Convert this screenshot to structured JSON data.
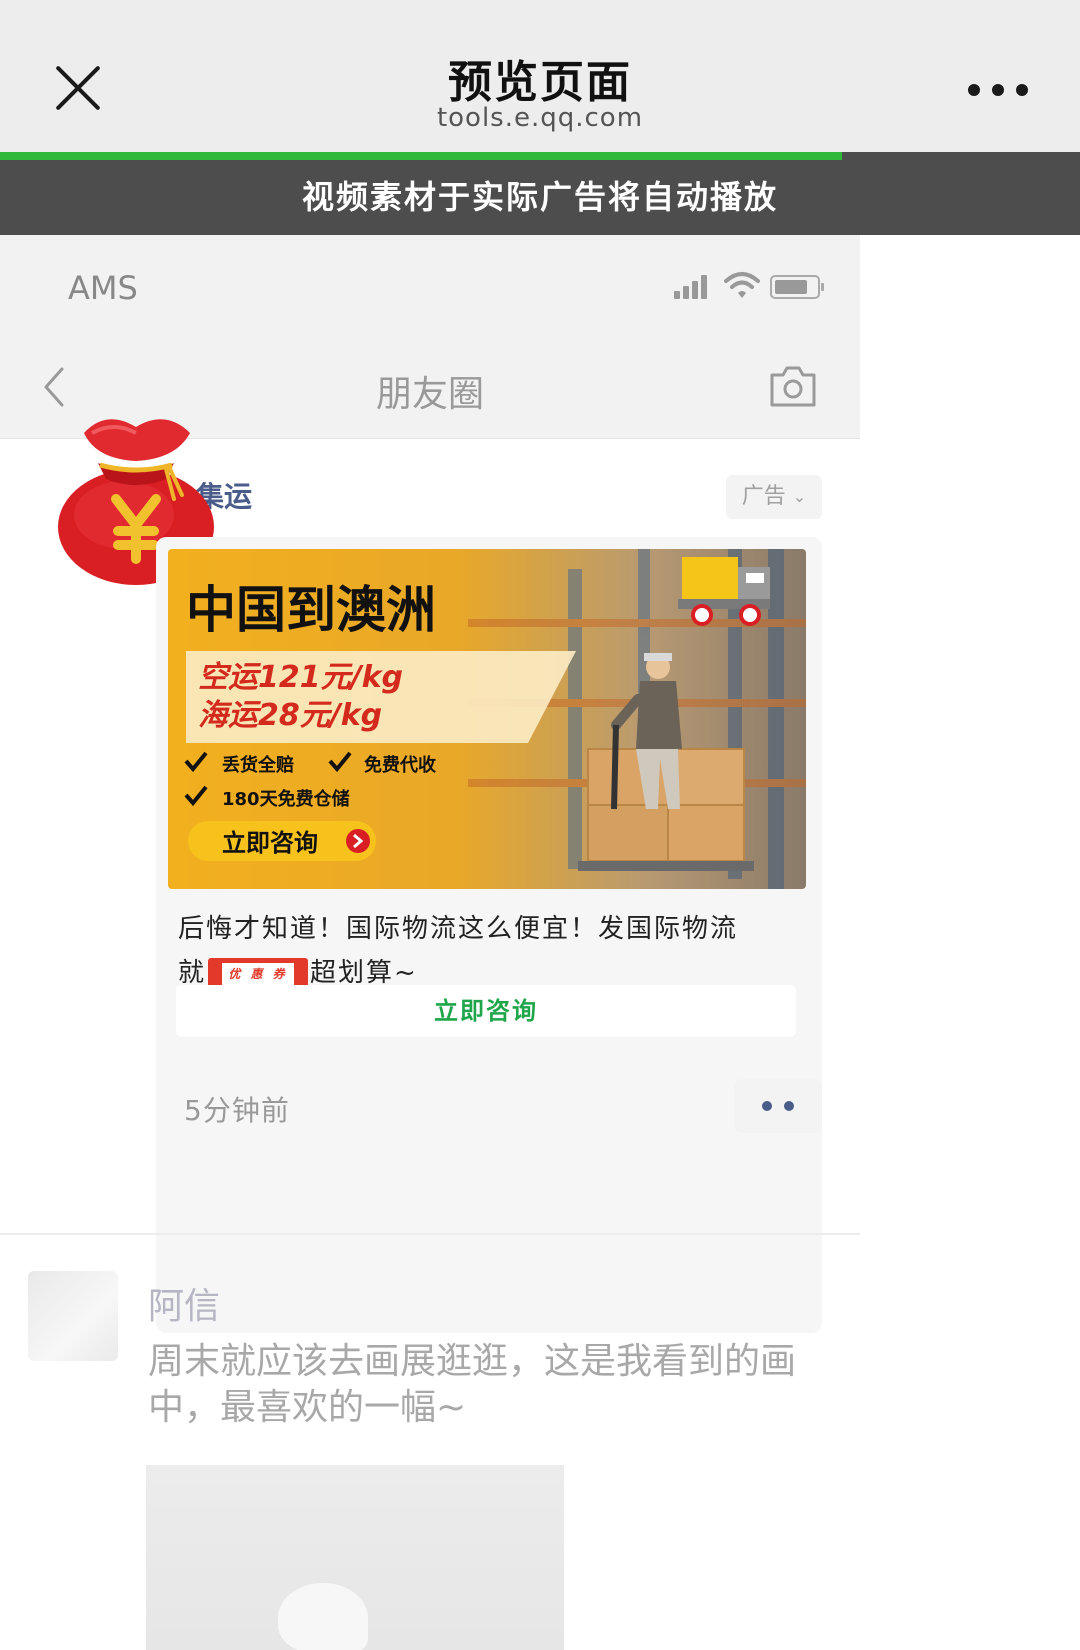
{
  "header": {
    "title": "预览页面",
    "domain": "tools.e.qq.com",
    "load_progress": 0.78
  },
  "notice": "视频素材于实际广告将自动播放",
  "phone": {
    "carrier": "AMS",
    "nav_title": "朋友圈"
  },
  "ad_post": {
    "advertiser_visible": "集运",
    "ad_tag": "广告",
    "banner": {
      "headline": "中国到澳洲",
      "price_air": "空运121元/kg",
      "price_sea": "海运28元/kg",
      "features": [
        "丢货全赔",
        "免费代收",
        "180天免费仓储"
      ],
      "button": "立即咨询"
    },
    "caption_line1": "后悔才知道！国际物流这么便宜！发国际物流",
    "caption_pre": "就",
    "coupon_label": "优 惠 券",
    "caption_post": "超划算~",
    "cta": "立即咨询",
    "time": "5分钟前"
  },
  "friend_post": {
    "name": "阿信",
    "text": "周末就应该去画展逛逛，这是我看到的画中，最喜欢的一幅~"
  },
  "colors": {
    "wechat_green": "#2fb83a",
    "link_blue": "#4a5d8a",
    "ad_orange": "#f0a81c",
    "coupon_red": "#e23a2a"
  }
}
